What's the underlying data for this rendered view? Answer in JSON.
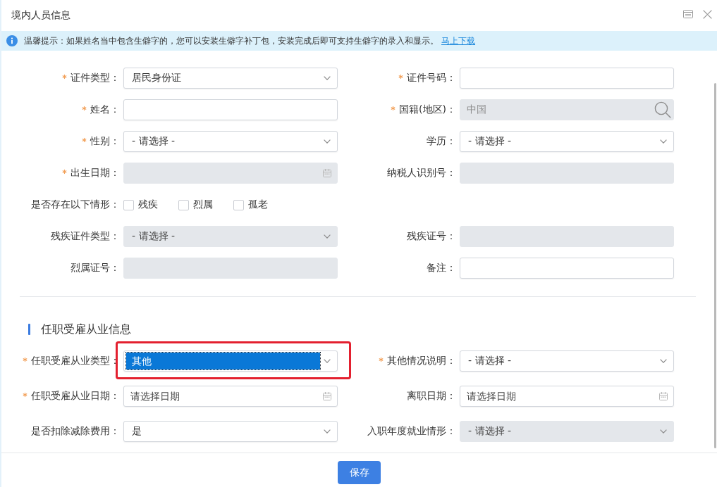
{
  "window": {
    "title": "境内人员信息"
  },
  "notice": {
    "text": "温馨提示：如果姓名当中包含生僻字的，您可以安装生僻字补丁包，安装完成后即可支持生僻字的录入和显示。",
    "link": "马上下载"
  },
  "sections": [
    {
      "rows": [
        [
          {
            "kind": "select",
            "label": "证件类型：",
            "required": true,
            "disabled": false,
            "value": "居民身份证"
          },
          {
            "kind": "text",
            "label": "证件号码：",
            "required": true,
            "disabled": false
          }
        ],
        [
          {
            "kind": "text",
            "label": "姓名：",
            "required": true,
            "disabled": false
          },
          {
            "kind": "search",
            "label": "国籍(地区)：",
            "required": true,
            "disabled": true,
            "value": "中国"
          }
        ],
        [
          {
            "kind": "select",
            "label": "性别：",
            "required": true,
            "disabled": false,
            "value": "- 请选择 -"
          },
          {
            "kind": "select",
            "label": "学历：",
            "required": false,
            "disabled": false,
            "value": "- 请选择 -"
          }
        ],
        [
          {
            "kind": "date",
            "label": "出生日期：",
            "required": true,
            "disabled": true
          },
          {
            "kind": "text",
            "label": "纳税人识别号：",
            "required": false,
            "disabled": true
          }
        ],
        [
          {
            "kind": "checks",
            "label": "是否存在以下情形：",
            "required": false,
            "options": [
              {
                "label": "残疾",
                "checked": false
              },
              {
                "label": "烈属",
                "checked": false
              },
              {
                "label": "孤老",
                "checked": false
              }
            ]
          }
        ],
        [
          {
            "kind": "select",
            "label": "残疾证件类型：",
            "required": false,
            "disabled": true,
            "value": "- 请选择 -"
          },
          {
            "kind": "text",
            "label": "残疾证号：",
            "required": false,
            "disabled": true
          }
        ],
        [
          {
            "kind": "text",
            "label": "烈属证号：",
            "required": false,
            "disabled": true
          },
          {
            "kind": "text",
            "label": "备注：",
            "required": false,
            "disabled": false
          }
        ]
      ]
    },
    {
      "title": "任职受雇从业信息",
      "rows": [
        [
          {
            "kind": "select",
            "label": "任职受雇从业类型：",
            "required": true,
            "disabled": false,
            "focused": true,
            "callout": true,
            "value": "其他"
          },
          {
            "kind": "select",
            "label": "其他情况说明：",
            "required": true,
            "disabled": false,
            "value": "- 请选择 -"
          }
        ],
        [
          {
            "kind": "date",
            "label": "任职受雇从业日期：",
            "required": true,
            "disabled": false,
            "placeholder": "请选择日期"
          },
          {
            "kind": "date",
            "label": "离职日期：",
            "required": false,
            "disabled": false,
            "placeholder": "请选择日期"
          }
        ],
        [
          {
            "kind": "select",
            "label": "是否扣除减除费用：",
            "required": false,
            "disabled": false,
            "value": "是"
          },
          {
            "kind": "select",
            "label": "入职年度就业情形：",
            "required": false,
            "disabled": true,
            "value": "- 请选择 -"
          }
        ]
      ]
    }
  ],
  "footer": {
    "buttons": [
      {
        "label": "保存"
      }
    ]
  }
}
